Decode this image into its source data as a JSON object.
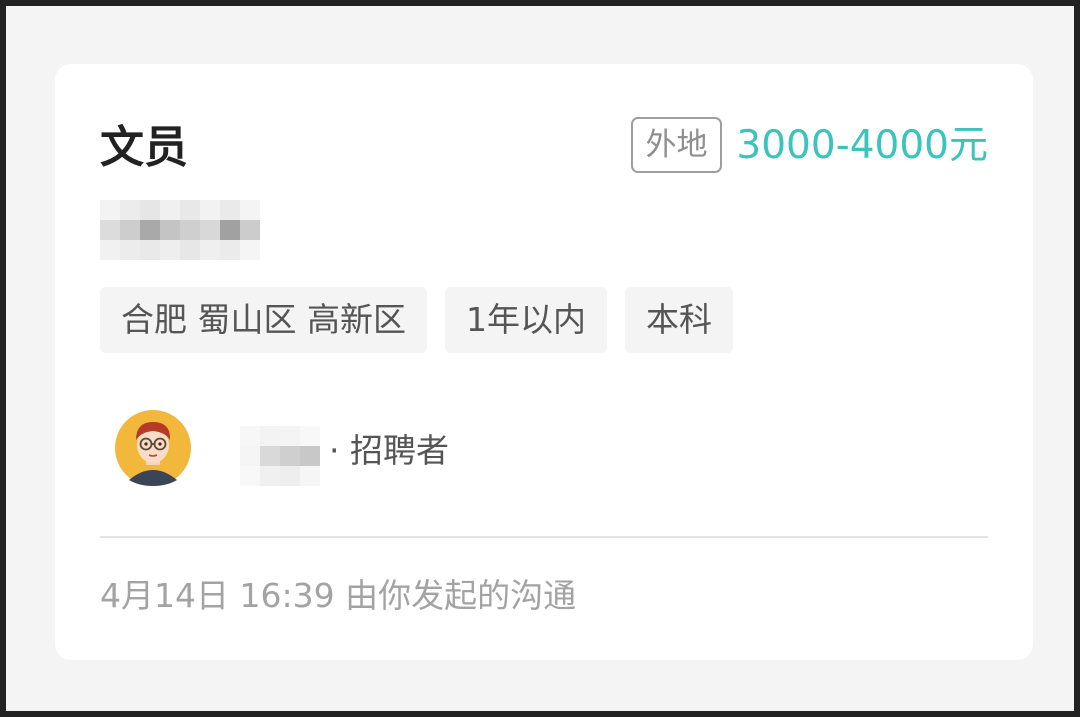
{
  "job": {
    "title": "文员",
    "location_badge": "外地",
    "salary": "3000-4000元"
  },
  "tags": [
    "合肥 蜀山区 高新区",
    "1年以内",
    "本科"
  ],
  "recruiter": {
    "role": "· 招聘者"
  },
  "footer": {
    "text": "4月14日 16:39 由你发起的沟通"
  },
  "colors": {
    "accent": "#3bc3bd",
    "background": "#f4f4f4",
    "card": "#ffffff"
  },
  "icons": {
    "avatar": "recruiter-avatar-icon"
  }
}
